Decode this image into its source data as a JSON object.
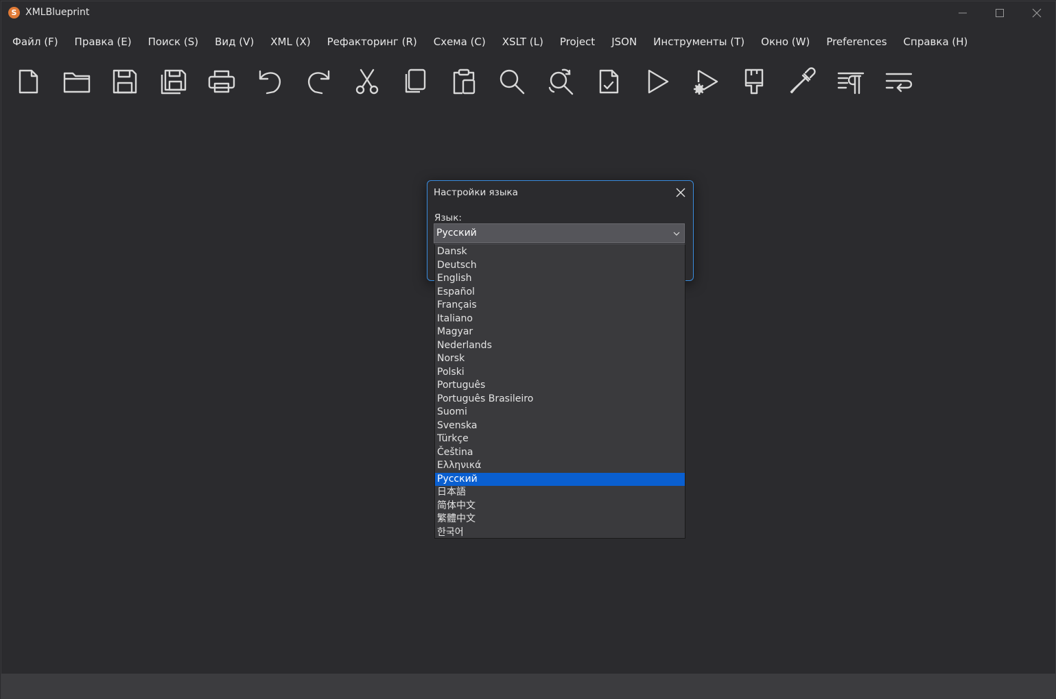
{
  "window": {
    "title": "XMLBlueprint",
    "icon_letter": "S",
    "controls": [
      "minimize-icon",
      "maximize-icon",
      "close-icon"
    ]
  },
  "menu": [
    {
      "label": "Файл (F)"
    },
    {
      "label": "Правка (E)"
    },
    {
      "label": "Поиск (S)"
    },
    {
      "label": "Вид (V)"
    },
    {
      "label": "XML (X)"
    },
    {
      "label": "Рефакторинг (R)"
    },
    {
      "label": "Схема (C)"
    },
    {
      "label": "XSLT (L)"
    },
    {
      "label": "Project"
    },
    {
      "label": "JSON"
    },
    {
      "label": "Инструменты (T)"
    },
    {
      "label": "Окно (W)"
    },
    {
      "label": "Preferences"
    },
    {
      "label": "Справка (H)"
    }
  ],
  "toolbar": [
    "new-file-icon",
    "open-folder-icon",
    "save-icon",
    "save-all-icon",
    "print-icon",
    "undo-icon",
    "redo-icon",
    "cut-icon",
    "copy-icon",
    "paste-icon",
    "find-icon",
    "find-replace-icon",
    "validate-icon",
    "run-icon",
    "run-settings-icon",
    "format-brush-icon",
    "color-picker-icon",
    "show-whitespace-icon",
    "word-wrap-icon"
  ],
  "dialog": {
    "title": "Настройки языка",
    "language_label": "Язык:",
    "selected": "Русский",
    "options": [
      "Dansk",
      "Deutsch",
      "English",
      "Español",
      "Français",
      "Italiano",
      "Magyar",
      "Nederlands",
      "Norsk",
      "Polski",
      "Português",
      "Português Brasileiro",
      "Suomi",
      "Svenska",
      "Türkçe",
      "Čeština",
      "Ελληνικά",
      "Русский",
      "日本語",
      "简体中文",
      "繁體中文",
      "한국어"
    ]
  },
  "colors": {
    "background": "#2b2b2e",
    "accent": "#3a8de0",
    "selection": "#0a5fd0",
    "icon": "#d8d8d8"
  }
}
